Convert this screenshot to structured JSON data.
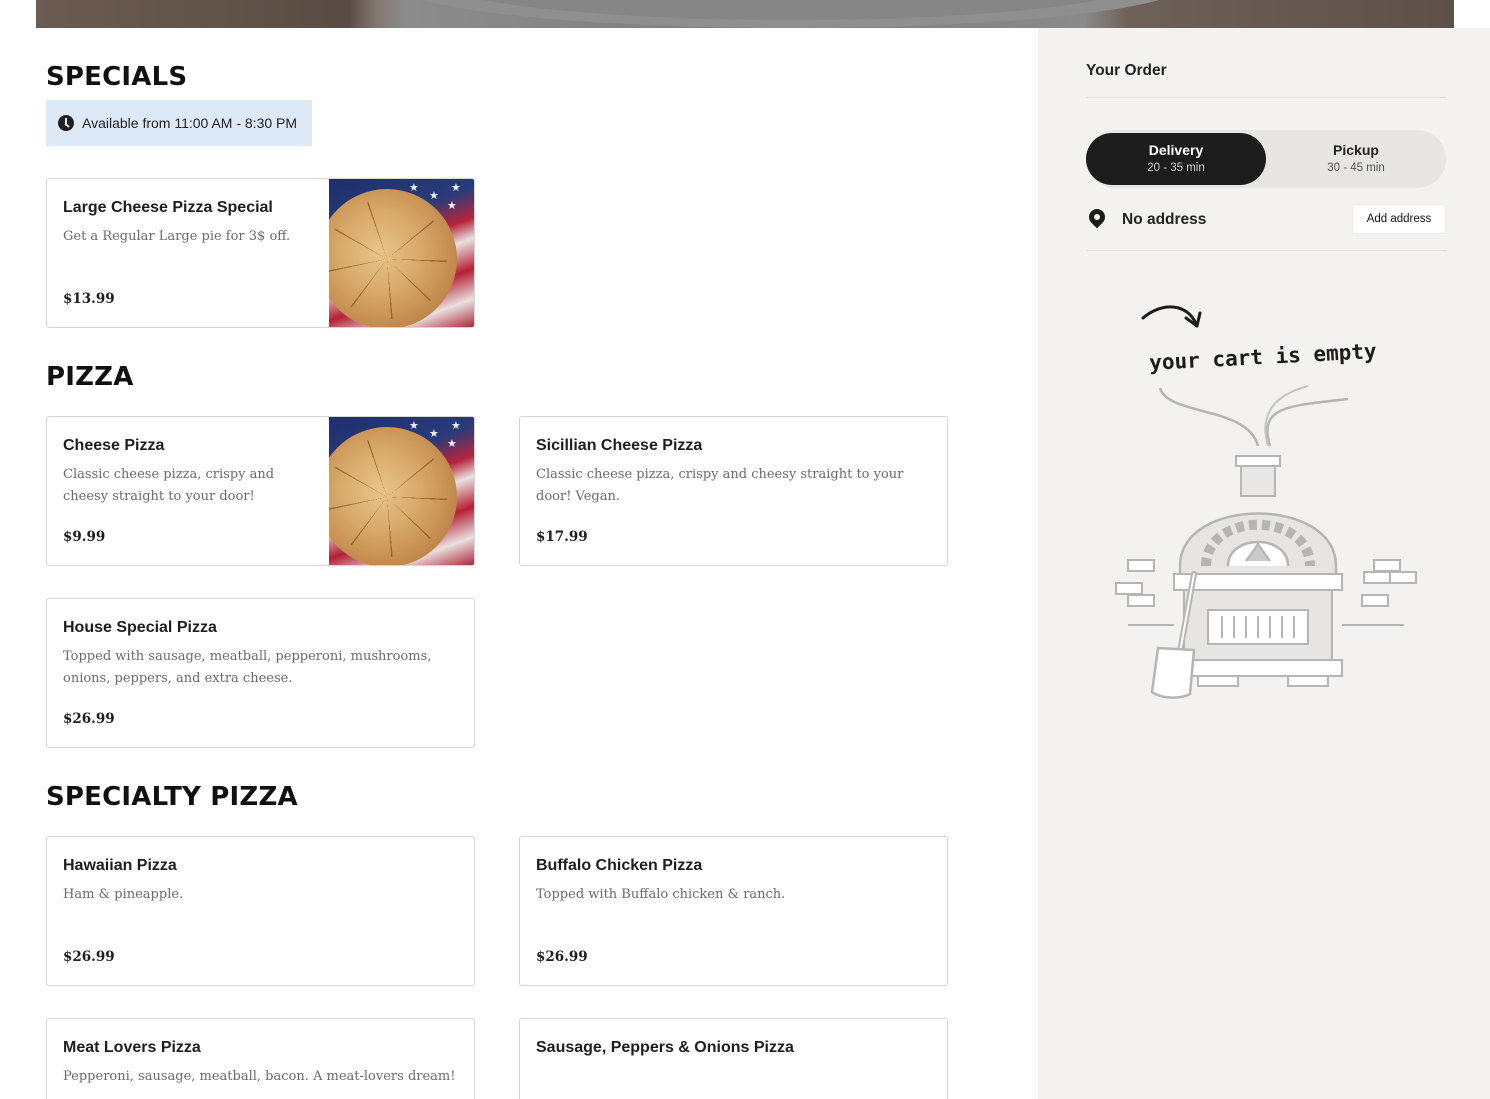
{
  "menu": {
    "specials": {
      "title": "SPECIALS",
      "availability": "Available from 11:00 AM - 8:30 PM",
      "items": [
        {
          "name": "Large Cheese Pizza Special",
          "description": "Get a Regular Large pie for 3$ off.",
          "price": "$13.99"
        }
      ]
    },
    "pizza": {
      "title": "PIZZA",
      "items": [
        {
          "name": "Cheese Pizza",
          "description": "Classic cheese pizza, crispy and cheesy straight to your door!",
          "price": "$9.99"
        },
        {
          "name": "Sicillian Cheese Pizza",
          "description": "Classic cheese pizza, crispy and cheesy straight to your door! Vegan.",
          "price": "$17.99"
        },
        {
          "name": "House Special Pizza",
          "description": "Topped with sausage, meatball, pepperoni, mushrooms, onions, peppers, and extra cheese.",
          "price": "$26.99"
        }
      ]
    },
    "specialty": {
      "title": "SPECIALTY PIZZA",
      "items": [
        {
          "name": "Hawaiian Pizza",
          "description": "Ham & pineapple.",
          "price": "$26.99"
        },
        {
          "name": "Buffalo Chicken Pizza",
          "description": "Topped with Buffalo chicken & ranch.",
          "price": "$26.99"
        },
        {
          "name": "Meat Lovers Pizza",
          "description": "Pepperoni, sausage, meatball, bacon. A meat-lovers dream!",
          "price": ""
        },
        {
          "name": "Sausage, Peppers & Onions Pizza",
          "description": "",
          "price": ""
        }
      ]
    }
  },
  "order": {
    "title": "Your Order",
    "delivery": {
      "label": "Delivery",
      "time": "20 - 35 min",
      "selected": true
    },
    "pickup": {
      "label": "Pickup",
      "time": "30 - 45 min",
      "selected": false
    },
    "address": {
      "text": "No address",
      "button": "Add address"
    },
    "empty_message": "your cart is empty"
  },
  "icons": {
    "availability": "clock-icon",
    "address": "location-pin-icon",
    "cart_empty": "pizza-oven-illustration",
    "arrow": "curved-arrow-icon"
  },
  "colors": {
    "availability_bg": "#dde9f7",
    "sidebar_bg": "#f3f2f0",
    "toggle_active": "#1c1c1c"
  }
}
